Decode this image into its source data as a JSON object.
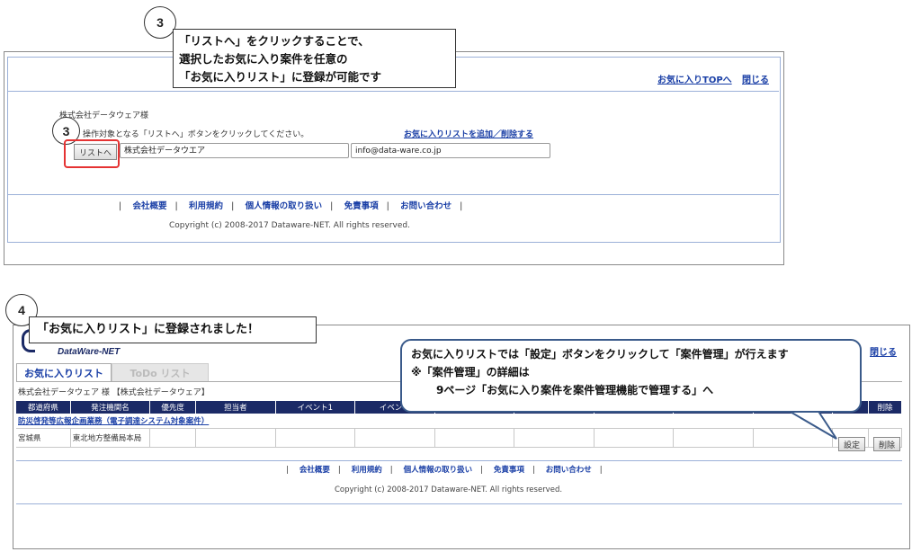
{
  "callout1": {
    "step": "3",
    "lines": [
      "「リストへ」をクリックすることで、",
      "選択したお気に入り案件を任意の",
      "「お気に入りリスト」に登録が可能です"
    ]
  },
  "top": {
    "links": {
      "fav_top": "お気に入りTOPへ",
      "close": "閉じる"
    },
    "company_greeting": "株式会社データウェア様",
    "instruction": "操作対象となる「リストへ」ボタンをクリックしてください。",
    "add_delete_link": "お気に入りリストを追加／削除する",
    "step": "3",
    "list_button": "リストへ",
    "company_field": "株式会社データウエア",
    "email_field": "info@data-ware.co.jp",
    "footer": [
      "会社概要",
      "利用規約",
      "個人情報の取り扱い",
      "免責事項",
      "お問い合わせ"
    ],
    "copyright": "Copyright (c) 2008-2017 Dataware-NET. All rights reserved."
  },
  "callout2": {
    "step": "4",
    "text": "「お気に入りリスト」に登録されました！"
  },
  "callout3": {
    "lines": [
      "お気に入りリストでは「設定」ボタンをクリックして「案件管理」が行えます",
      "※「案件管理」の詳細は",
      "9ページ「お気に入り案件を案件管理機能で管理する」へ"
    ]
  },
  "bottom": {
    "logo": "DataWare-NET",
    "close": "閉じる",
    "tabs": [
      "お気に入りリスト",
      "ToDo リスト"
    ],
    "user_line": "株式会社データウェア 様 【株式会社データウェア】",
    "table_headers": [
      "都道府県",
      "発注機関名",
      "優先度",
      "担当者",
      "イベント1",
      "イベント",
      "",
      "",
      "",
      "",
      "",
      "",
      "削除"
    ],
    "project_title": "防災啓発等広報企画業務（電子調達システム対象案件）",
    "row": {
      "prefecture": "宮城県",
      "agency": "東北地方整備局本局"
    },
    "buttons": {
      "settings": "設定",
      "delete": "削除"
    },
    "footer": [
      "会社概要",
      "利用規約",
      "個人情報の取り扱い",
      "免責事項",
      "お問い合わせ"
    ],
    "copyright": "Copyright (c) 2008-2017 Dataware-NET. All rights reserved."
  },
  "colors": {
    "accent": "#1a3fa6",
    "header_bg": "#1b2a66",
    "highlight": "#e53333",
    "tab_active": "#1a3fa6"
  }
}
